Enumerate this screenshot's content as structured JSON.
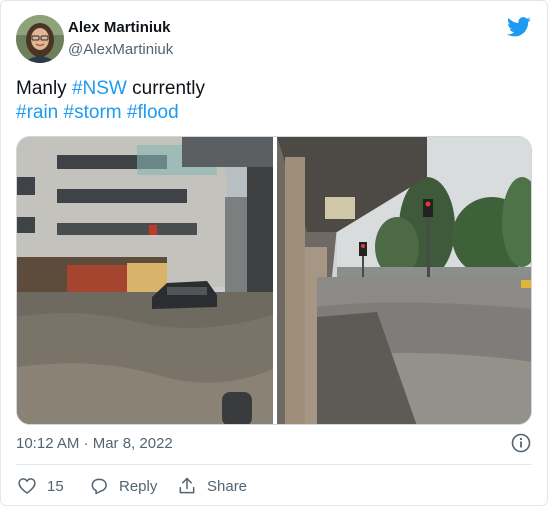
{
  "tweet": {
    "author_name": "Alex Martiniuk",
    "author_handle": "@AlexMartiniuk",
    "text_plain_1": "Manly ",
    "hashtag_nsw": "#NSW",
    "text_plain_2": " currently",
    "hashtag_rain": "#rain",
    "hashtag_storm": "#storm",
    "hashtag_flood": "#flood",
    "timestamp": "10:12 AM · Mar 8, 2022",
    "like_count": "15",
    "reply_label": "Reply",
    "share_label": "Share"
  },
  "colors": {
    "brand": "#1d9bf0",
    "text": "#0f1419",
    "secondary": "#536471"
  },
  "icons": [
    "twitter-bird-icon",
    "info-icon",
    "heart-icon",
    "reply-icon",
    "share-icon"
  ]
}
